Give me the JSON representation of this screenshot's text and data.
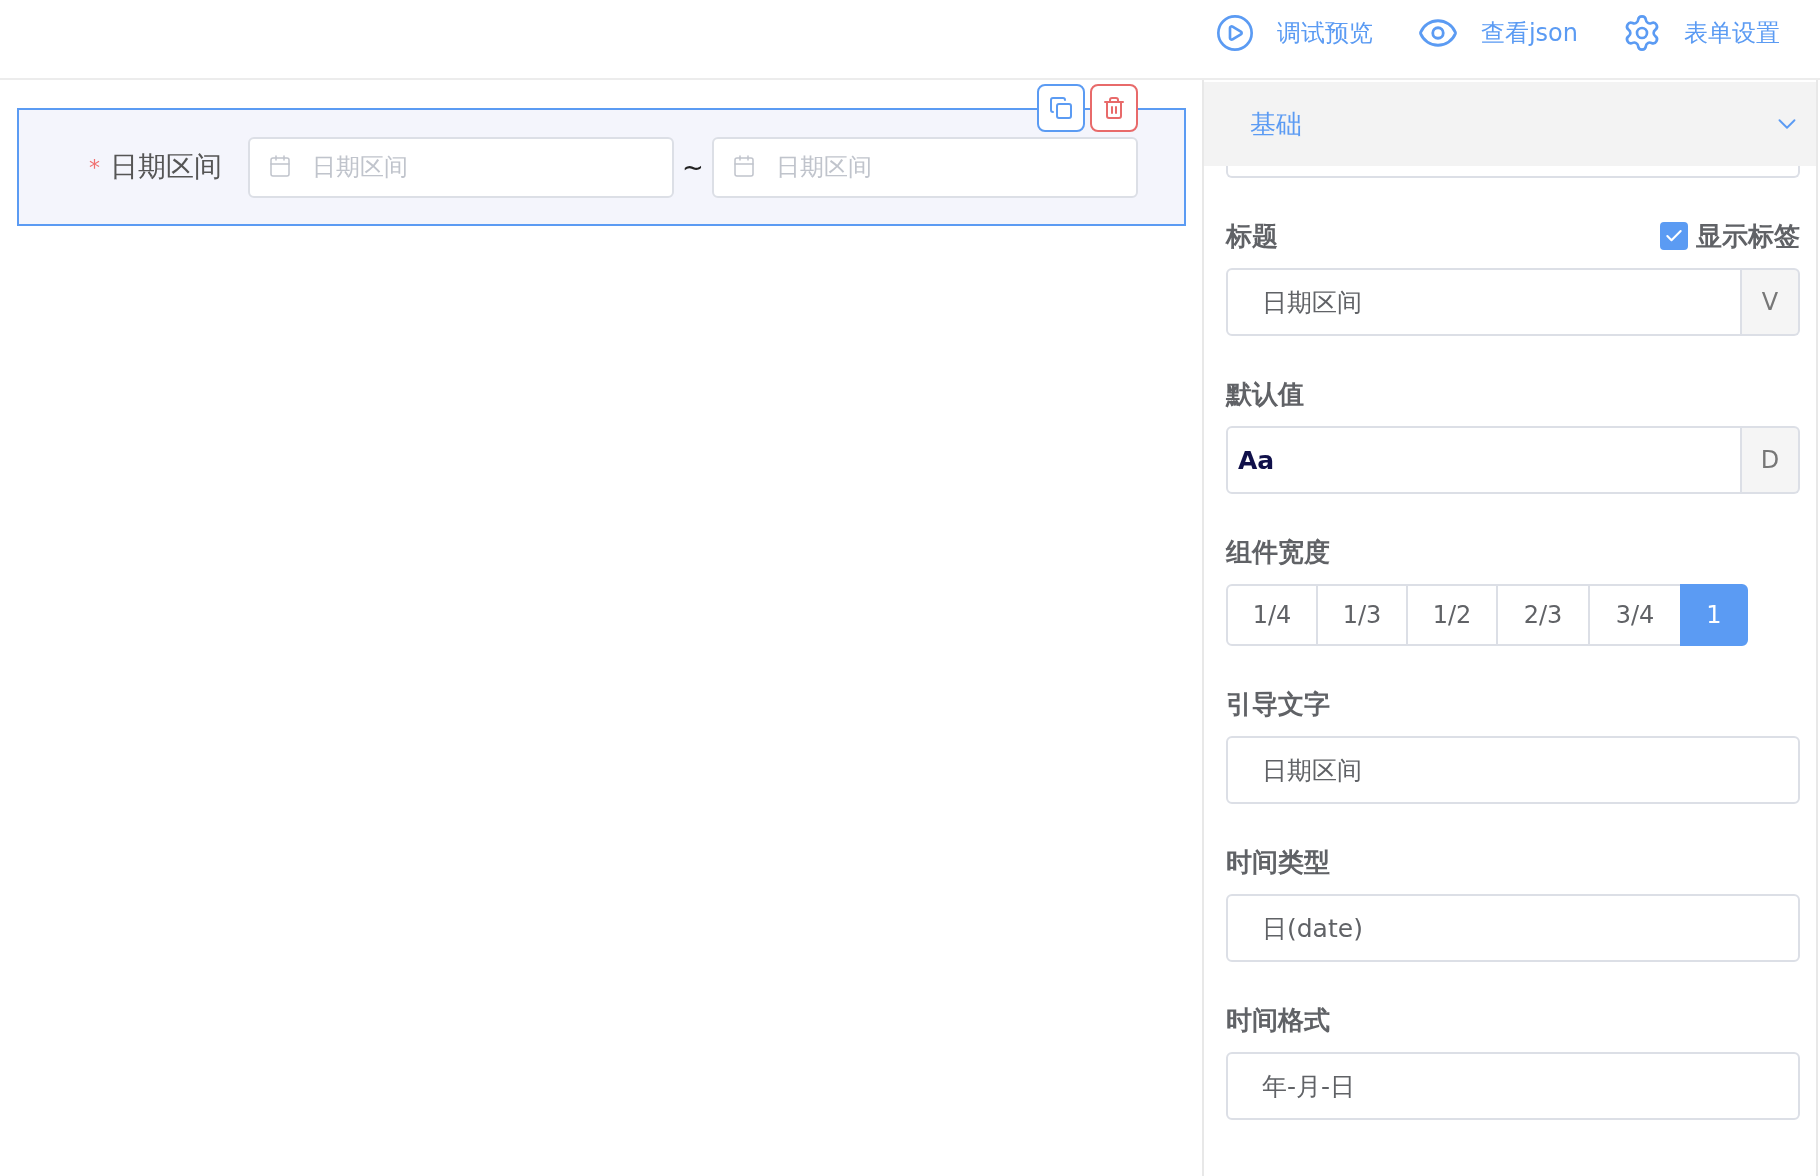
{
  "toolbar": [
    {
      "kind": "preview",
      "label": "调试预览"
    },
    {
      "kind": "json",
      "label": "查看json"
    },
    {
      "kind": "settings",
      "label": "表单设置"
    }
  ],
  "canvas": {
    "item": {
      "label": "日期区间",
      "required_mark": "*",
      "selected": true,
      "start_placeholder": "日期区间",
      "separator": "~",
      "end_placeholder": "日期区间"
    }
  },
  "panel": {
    "section": {
      "title": "基础",
      "expanded": true
    },
    "title_field": {
      "label": "标题",
      "show_label": {
        "label": "显示标签",
        "checked": true
      },
      "value": "日期区间",
      "addon": "V"
    },
    "default_field": {
      "label": "默认值",
      "value": "Aa",
      "addon": "D"
    },
    "width_field": {
      "label": "组件宽度",
      "options": [
        {
          "label": "1/4",
          "selected": false
        },
        {
          "label": "1/3",
          "selected": false
        },
        {
          "label": "1/2",
          "selected": false
        },
        {
          "label": "2/3",
          "selected": false
        },
        {
          "label": "3/4",
          "selected": false
        },
        {
          "label": "1",
          "selected": true
        }
      ]
    },
    "placeholder_field": {
      "label": "引导文字",
      "value": "日期区间"
    },
    "type_field": {
      "label": "时间类型",
      "value": "日(date)"
    },
    "format_field": {
      "label": "时间格式",
      "value": "年-月-日"
    }
  }
}
